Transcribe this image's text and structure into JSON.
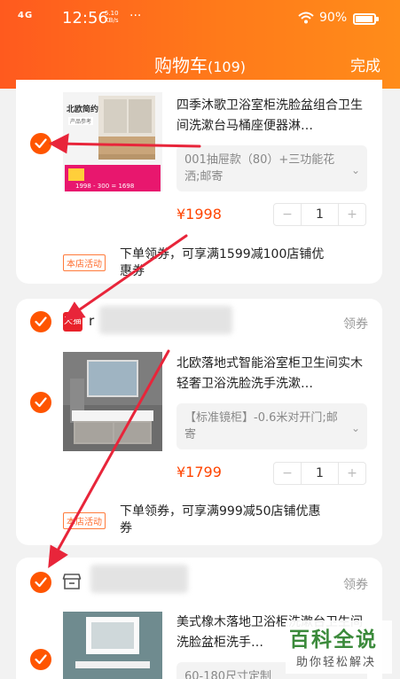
{
  "status_bar": {
    "signal": "4G",
    "time": "12:56",
    "speed_value": "5.10",
    "speed_unit": "KB/s",
    "more": "···",
    "battery": "90%"
  },
  "header": {
    "title": "购物车",
    "count": "(109)",
    "done": "完成"
  },
  "shops": [
    {
      "items": [
        {
          "title": "四季沐歌卫浴室柜洗脸盆组合卫生间洗漱台马桶座便器淋…",
          "sku": "001抽屉款（80）+三功能花洒;邮寄",
          "price": "¥1998",
          "qty": "1",
          "thumb": {
            "brand": "北欧简约",
            "sub": "产品参考",
            "banner": "1998 - 300 = 1698"
          }
        }
      ],
      "promo": {
        "tag": "本店活动",
        "text": "下单领券，可享满1599减100店铺优惠券"
      }
    },
    {
      "store_icon": "天猫",
      "store_initial": "r",
      "coupon": "领券",
      "items": [
        {
          "title": "北欧落地式智能浴室柜卫生间实木轻奢卫浴洗脸洗手洗漱…",
          "sku": "【标准镜柜】-0.6米对开门;邮寄",
          "price": "¥1799",
          "qty": "1"
        }
      ],
      "promo": {
        "tag": "本店活动",
        "text": "下单领券，可享满999减50店铺优惠券"
      }
    },
    {
      "store_icon": "store-icon",
      "coupon": "领券",
      "items": [
        {
          "title": "美式橡木落地卫浴柜洗漱台卫生间洗脸盆柜洗手…",
          "sku": "60-180尺寸定制"
        }
      ]
    }
  ],
  "watermark": {
    "main": "百科全说",
    "sub": "助你轻松解决"
  },
  "colors": {
    "accent": "#ff5500",
    "header_start": "#ff5a1e",
    "header_end": "#ff8c1a",
    "price": "#ff4400",
    "arrow": "#e8253a"
  }
}
